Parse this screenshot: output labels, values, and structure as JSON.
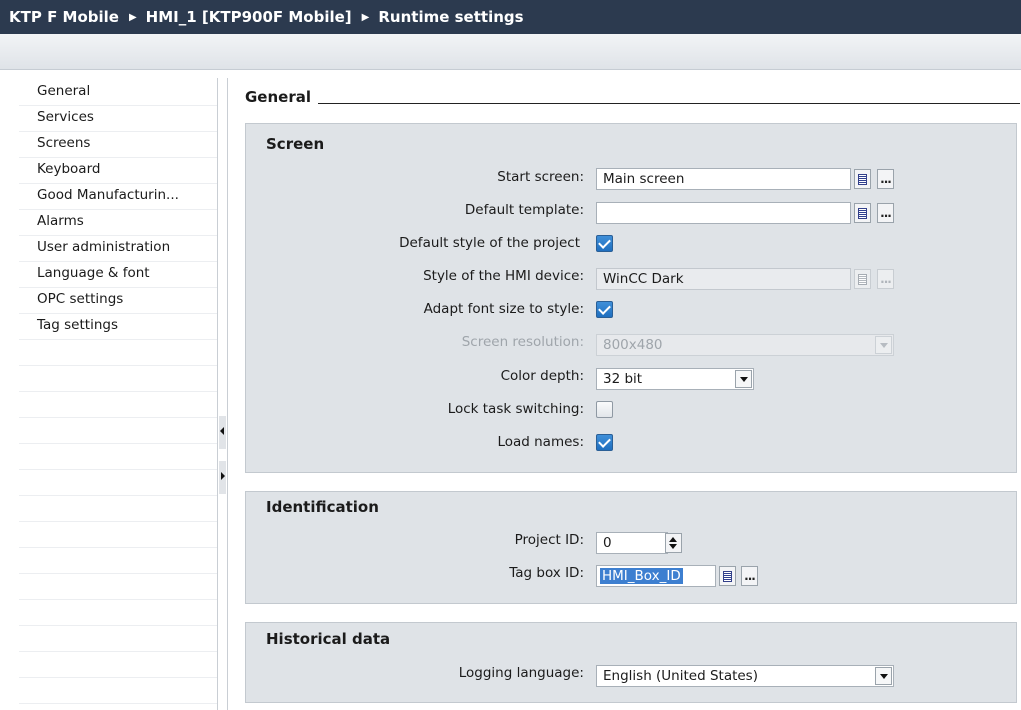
{
  "breadcrumb": [
    "KTP F Mobile",
    "HMI_1 [KTP900F Mobile]",
    "Runtime settings"
  ],
  "sidebar": {
    "items": [
      {
        "label": "General"
      },
      {
        "label": "Services"
      },
      {
        "label": "Screens"
      },
      {
        "label": "Keyboard"
      },
      {
        "label": "Good Manufacturin..."
      },
      {
        "label": "Alarms"
      },
      {
        "label": "User administration"
      },
      {
        "label": "Language & font"
      },
      {
        "label": "OPC settings"
      },
      {
        "label": "Tag settings"
      }
    ]
  },
  "main": {
    "title": "General",
    "screen": {
      "title": "Screen",
      "start_screen_label": "Start screen:",
      "start_screen_value": "Main screen",
      "default_template_label": "Default template:",
      "default_template_value": "",
      "default_style_label": "Default style of the project",
      "default_style_checked": true,
      "style_device_label": "Style of the HMI device:",
      "style_device_value": "WinCC Dark",
      "adapt_font_label": "Adapt font size to style:",
      "adapt_font_checked": true,
      "resolution_label": "Screen resolution:",
      "resolution_value": "800x480",
      "color_depth_label": "Color depth:",
      "color_depth_value": "32 bit",
      "lock_task_label": "Lock task switching:",
      "lock_task_checked": false,
      "load_names_label": "Load names:",
      "load_names_checked": true
    },
    "identification": {
      "title": "Identification",
      "project_id_label": "Project ID:",
      "project_id_value": "0",
      "tag_box_label": "Tag box ID:",
      "tag_box_value": "HMI_Box_ID"
    },
    "historical": {
      "title": "Historical data",
      "logging_language_label": "Logging language:",
      "logging_language_value": "English (United States)"
    }
  },
  "icons": {
    "breadcrumb_separator": "breadcrumb-arrow-icon",
    "list_picker": "list-icon",
    "browse": "ellipsis-icon",
    "dropdown": "chevron-down-icon",
    "spinner": "spin-arrows-icon",
    "collapse_left": "arrow-left-icon",
    "collapse_right": "arrow-right-icon"
  },
  "colors": {
    "titlebar_bg": "#2c3a4f",
    "section_bg": "#dfe3e7",
    "checkbox_on": "#2f7fcf",
    "selection": "#3d7fd0"
  }
}
